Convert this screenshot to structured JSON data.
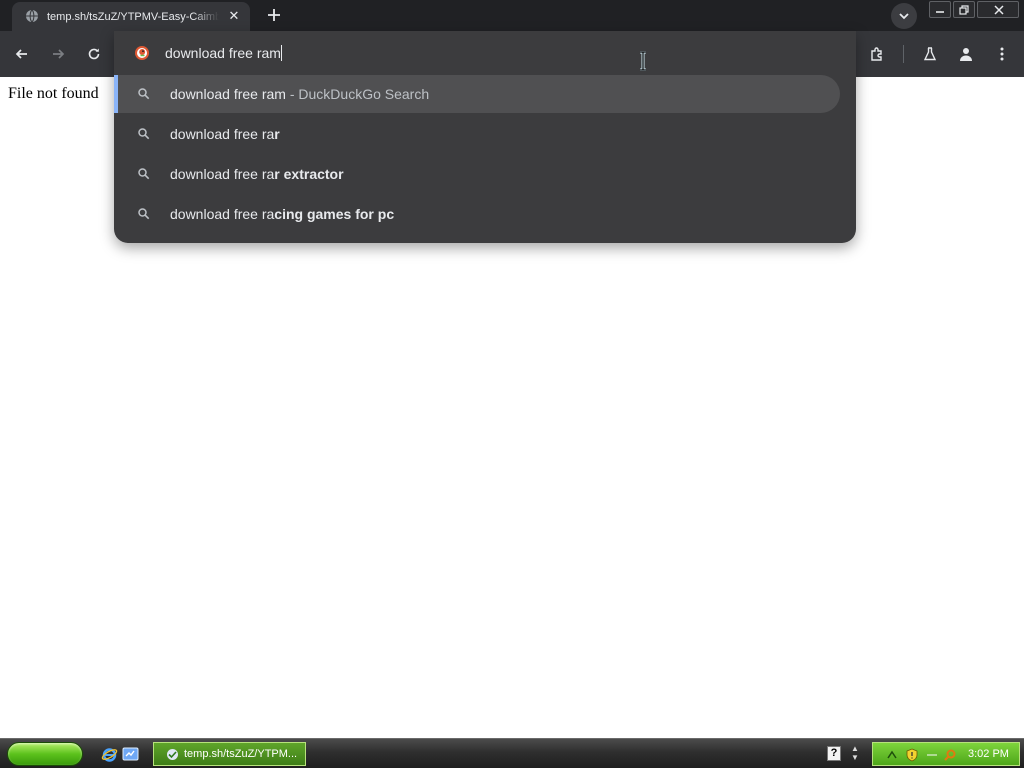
{
  "browser": {
    "tab": {
      "title": "temp.sh/tsZuZ/YTPMV-Easy-Caimb",
      "close_label": "✕"
    },
    "omnibox": {
      "value": "download free ram",
      "search_engine_icon": "duckduckgo-icon"
    },
    "suggestions": [
      {
        "prefix": "download free ram",
        "suffix": "",
        "sub": " - DuckDuckGo Search"
      },
      {
        "prefix": "download free ra",
        "suffix": "r",
        "sub": ""
      },
      {
        "prefix": "download free ra",
        "suffix": "r extractor",
        "sub": ""
      },
      {
        "prefix": "download free ra",
        "suffix": "cing games for pc",
        "sub": ""
      }
    ],
    "colors": {
      "accent": "#8ab4f8",
      "popup_bg": "#3c3c3e",
      "toolbar_bg": "#35363a"
    }
  },
  "page": {
    "body_text": "File not found"
  },
  "taskbar": {
    "task_label": "temp.sh/tsZuZ/YTPM...",
    "clock": "3:02 PM",
    "help_label": "?"
  }
}
